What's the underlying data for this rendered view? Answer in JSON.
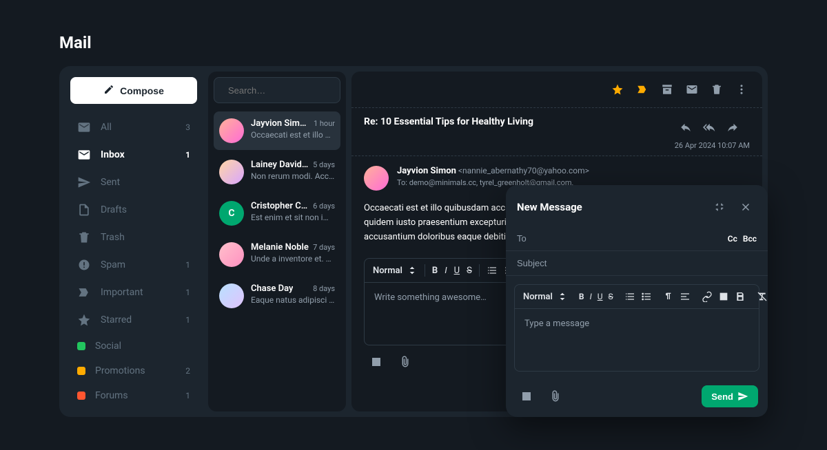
{
  "pageTitle": "Mail",
  "composeLabel": "Compose",
  "sidebar": {
    "items": [
      {
        "label": "All",
        "count": "3"
      },
      {
        "label": "Inbox",
        "count": "1"
      },
      {
        "label": "Sent",
        "count": ""
      },
      {
        "label": "Drafts",
        "count": ""
      },
      {
        "label": "Trash",
        "count": ""
      },
      {
        "label": "Spam",
        "count": "1"
      },
      {
        "label": "Important",
        "count": "1"
      },
      {
        "label": "Starred",
        "count": "1"
      },
      {
        "label": "Social",
        "count": ""
      },
      {
        "label": "Promotions",
        "count": "2"
      },
      {
        "label": "Forums",
        "count": "1"
      }
    ]
  },
  "search": {
    "placeholder": "Search…"
  },
  "mailList": [
    {
      "name": "Jayvion Simon",
      "preview": "Occaecati est et illo qui…",
      "time": "1 hour"
    },
    {
      "name": "Lainey Davidson",
      "preview": "Non rerum modi. Accus…",
      "time": "5 days"
    },
    {
      "name": "Cristopher Cardenas",
      "preview": "Est enim et sit non imp…",
      "time": "6 days"
    },
    {
      "name": "Melanie Noble",
      "preview": "Unde a inventore et. Se…",
      "time": "7 days"
    },
    {
      "name": "Chase Day",
      "preview": "Eaque natus adipisci so…",
      "time": "8 days"
    }
  ],
  "detail": {
    "subject": "Re: 10 Essential Tips for Healthy Living",
    "date": "26 Apr 2024 10:07 AM",
    "senderName": "Jayvion Simon",
    "senderEmail": "<nannie_abernathy70@yahoo.com>",
    "toLabel": "To:",
    "toValue": "demo@minimals.cc, tyrel_greenholt@gmail.com,",
    "body": "Occaecati est et illo quibusdam accusamus qui. Incidunt aut et molestiae ut facere aut. Est quidem iusto praesentium excepturi harum nihil tenetur facilis. Ut omnis voluptates nihil accusantium doloribus eaque debitis.",
    "editorPlaceholder": "Write something awesome…",
    "normalLabel": "Normal"
  },
  "compose": {
    "title": "New Message",
    "toPlaceholder": "To",
    "cc": "Cc",
    "bcc": "Bcc",
    "subjectPlaceholder": "Subject",
    "bodyPlaceholder": "Type a message",
    "normalLabel": "Normal",
    "sendLabel": "Send"
  },
  "colors": {
    "accent": "#00a76f",
    "star": "#ffab00",
    "important": "#ffab00"
  }
}
